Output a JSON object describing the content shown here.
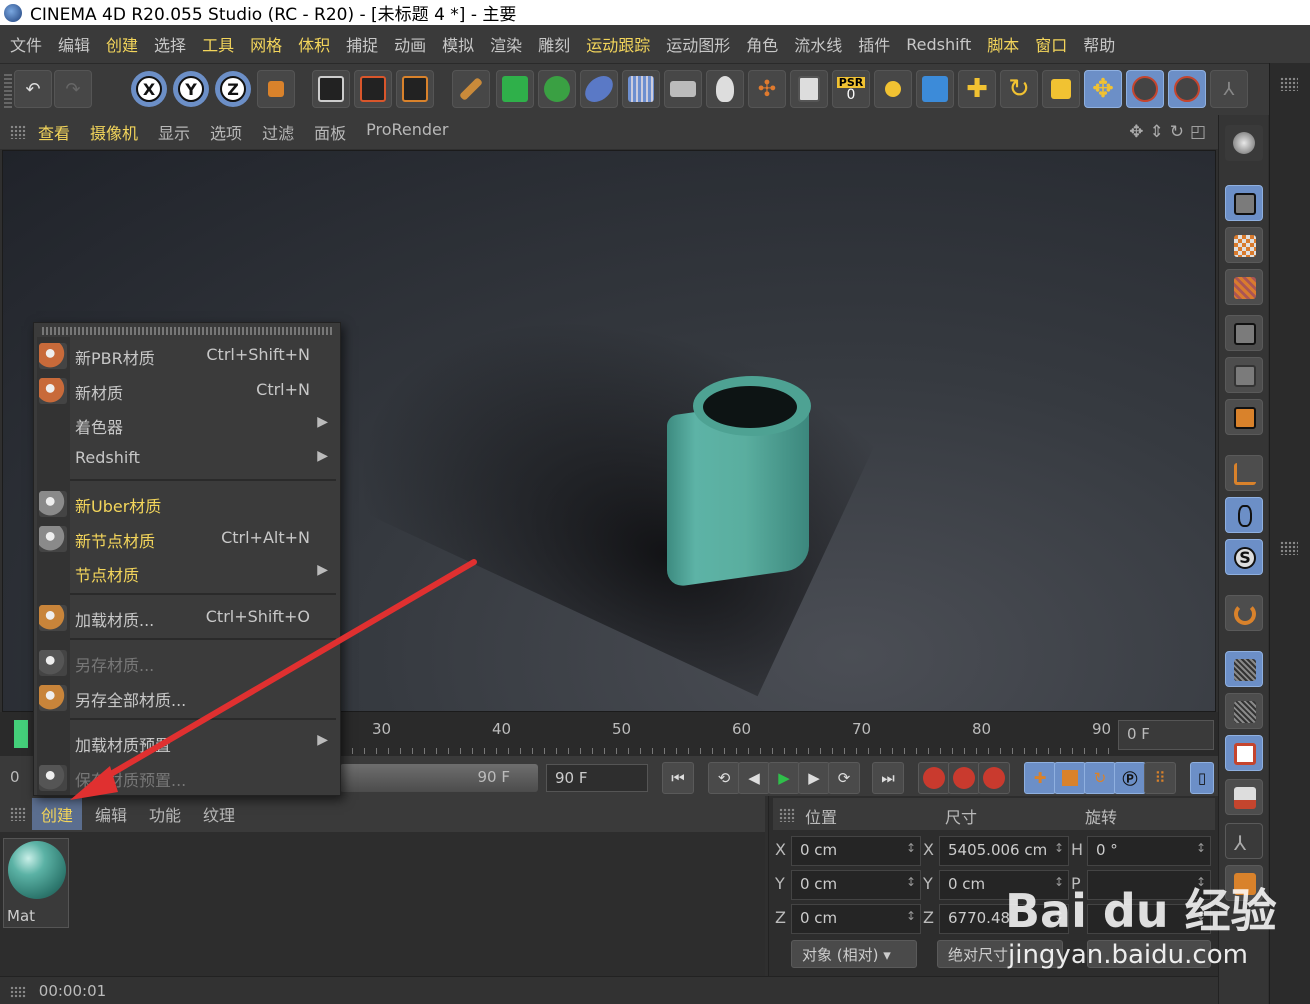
{
  "window": {
    "title": "CINEMA 4D R20.055 Studio (RC - R20) - [未标题 4 *] - 主要"
  },
  "menubar": [
    {
      "label": "文件",
      "hl": false
    },
    {
      "label": "编辑",
      "hl": false
    },
    {
      "label": "创建",
      "hl": true
    },
    {
      "label": "选择",
      "hl": false
    },
    {
      "label": "工具",
      "hl": true
    },
    {
      "label": "网格",
      "hl": true
    },
    {
      "label": "体积",
      "hl": true
    },
    {
      "label": "捕捉",
      "hl": false
    },
    {
      "label": "动画",
      "hl": false
    },
    {
      "label": "模拟",
      "hl": false
    },
    {
      "label": "渲染",
      "hl": false
    },
    {
      "label": "雕刻",
      "hl": false
    },
    {
      "label": "运动跟踪",
      "hl": true
    },
    {
      "label": "运动图形",
      "hl": false
    },
    {
      "label": "角色",
      "hl": false
    },
    {
      "label": "流水线",
      "hl": false
    },
    {
      "label": "插件",
      "hl": false
    },
    {
      "label": "Redshift",
      "hl": false
    },
    {
      "label": "脚本",
      "hl": true
    },
    {
      "label": "窗口",
      "hl": true
    },
    {
      "label": "帮助",
      "hl": false
    }
  ],
  "toolbar": {
    "axes": [
      "X",
      "Y",
      "Z"
    ],
    "psr_label": "PSR",
    "psr_value": "0"
  },
  "viewport": {
    "menu": [
      {
        "label": "查看",
        "hl": true
      },
      {
        "label": "摄像机",
        "hl": true
      },
      {
        "label": "显示",
        "hl": false
      },
      {
        "label": "选项",
        "hl": false
      },
      {
        "label": "过滤",
        "hl": false
      },
      {
        "label": "面板",
        "hl": false
      },
      {
        "label": "ProRender",
        "hl": false
      }
    ]
  },
  "timeline": {
    "ticks": [
      "30",
      "40",
      "50",
      "60",
      "70",
      "80",
      "90"
    ],
    "current_frame": "0 F",
    "start_field": "0",
    "end_slider": "90 F",
    "end_field": "90 F"
  },
  "popup_menu": {
    "items": [
      {
        "label": "新PBR材质",
        "shortcut": "Ctrl+Shift+N",
        "submenu": false,
        "style": "normal",
        "icon": "material-pbr-icon",
        "icon_color": "#c86a3a"
      },
      {
        "label": "新材质",
        "shortcut": "Ctrl+N",
        "submenu": false,
        "style": "normal",
        "icon": "material-new-icon",
        "icon_color": "#c86a3a"
      },
      {
        "label": "着色器",
        "shortcut": "",
        "submenu": true,
        "style": "normal",
        "icon": "",
        "icon_color": ""
      },
      {
        "label": "Redshift",
        "shortcut": "",
        "submenu": true,
        "style": "normal",
        "icon": "",
        "icon_color": ""
      },
      {
        "label": "新Uber材质",
        "shortcut": "",
        "submenu": false,
        "style": "hl",
        "icon": "uber-material-icon",
        "icon_color": "#8a8a8a"
      },
      {
        "label": "新节点材质",
        "shortcut": "Ctrl+Alt+N",
        "submenu": false,
        "style": "hl",
        "icon": "node-material-icon",
        "icon_color": "#8a8a8a"
      },
      {
        "label": "节点材质",
        "shortcut": "",
        "submenu": true,
        "style": "hl",
        "icon": "",
        "icon_color": ""
      },
      {
        "label": "加载材质...",
        "shortcut": "Ctrl+Shift+O",
        "submenu": false,
        "style": "normal",
        "icon": "load-material-icon",
        "icon_color": "#c8843a"
      },
      {
        "label": "另存材质...",
        "shortcut": "",
        "submenu": false,
        "style": "dis",
        "icon": "save-material-icon",
        "icon_color": "#555555"
      },
      {
        "label": "另存全部材质...",
        "shortcut": "",
        "submenu": false,
        "style": "normal",
        "icon": "save-all-materials-icon",
        "icon_color": "#c8843a"
      },
      {
        "label": "加载材质预置",
        "shortcut": "",
        "submenu": true,
        "style": "normal",
        "icon": "",
        "icon_color": ""
      },
      {
        "label": "保存材质预置...",
        "shortcut": "",
        "submenu": false,
        "style": "dis",
        "icon": "save-preset-icon",
        "icon_color": "#555555"
      }
    ]
  },
  "material_manager": {
    "tabs": [
      {
        "label": "创建",
        "active": true
      },
      {
        "label": "编辑",
        "active": false
      },
      {
        "label": "功能",
        "active": false
      },
      {
        "label": "纹理",
        "active": false
      }
    ],
    "materials": [
      {
        "name": "Mat"
      }
    ]
  },
  "attributes": {
    "headers": {
      "position": "位置",
      "size": "尺寸",
      "rotation": "旋转"
    },
    "rows": [
      {
        "axis": "X",
        "pos": "0 cm",
        "size_axis": "X",
        "size": "5405.006 cm",
        "rot_axis": "H",
        "rot": "0 °"
      },
      {
        "axis": "Y",
        "pos": "0 cm",
        "size_axis": "Y",
        "size": "0 cm",
        "rot_axis": "P",
        "rot": ""
      },
      {
        "axis": "Z",
        "pos": "0 cm",
        "size_axis": "Z",
        "size": "6770.48",
        "rot_axis": "",
        "rot": ""
      }
    ],
    "mode_dropdown": "对象 (相对)",
    "size_dropdown": "绝对尺寸"
  },
  "status": {
    "time": "00:00:01"
  },
  "watermark": {
    "brand": "Bai du 经验",
    "url": "jingyan.baidu.com"
  },
  "colors": {
    "accent_yellow": "#f3d55b",
    "tool_blue": "#6c8fc7",
    "arrow_red": "#e03030",
    "jar_teal": "#5aae9f"
  }
}
